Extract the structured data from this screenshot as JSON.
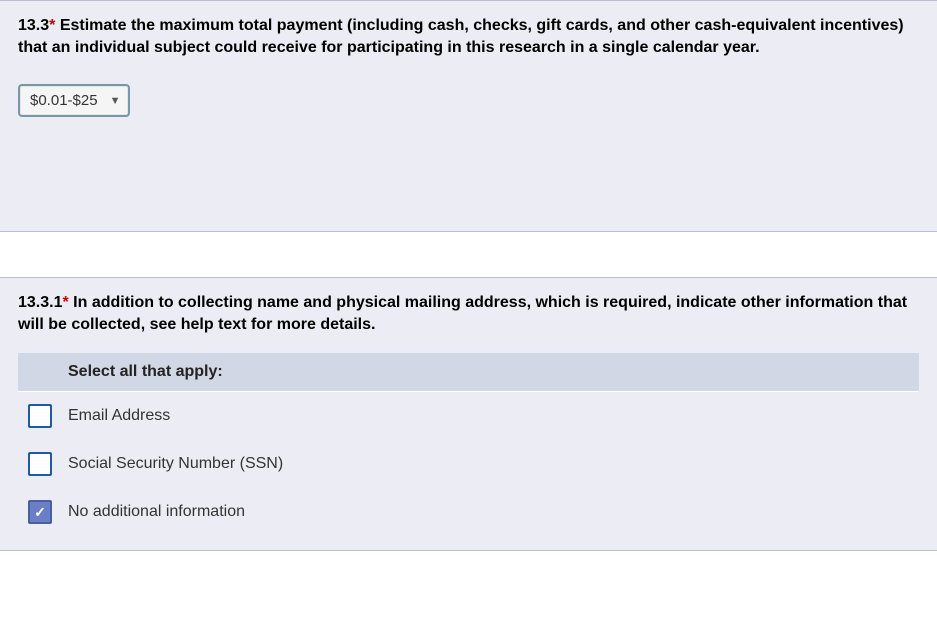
{
  "q1": {
    "number": "13.3",
    "asterisk": "*",
    "text": "  Estimate the maximum total payment (including cash, checks, gift cards, and other cash-equivalent incentives) that an individual subject could receive for participating in this research in a single calendar year.",
    "dropdown_value": "$0.01-$25"
  },
  "q2": {
    "number": "13.3.1",
    "asterisk": "*",
    "text": "  In addition to collecting name and physical mailing address, which is required, indicate other information that will be collected, see help text for more details.",
    "header": "Select all that apply:",
    "options": [
      {
        "label": "Email Address",
        "checked": false
      },
      {
        "label": "Social Security Number (SSN)",
        "checked": false
      },
      {
        "label": "No additional information",
        "checked": true
      }
    ]
  }
}
